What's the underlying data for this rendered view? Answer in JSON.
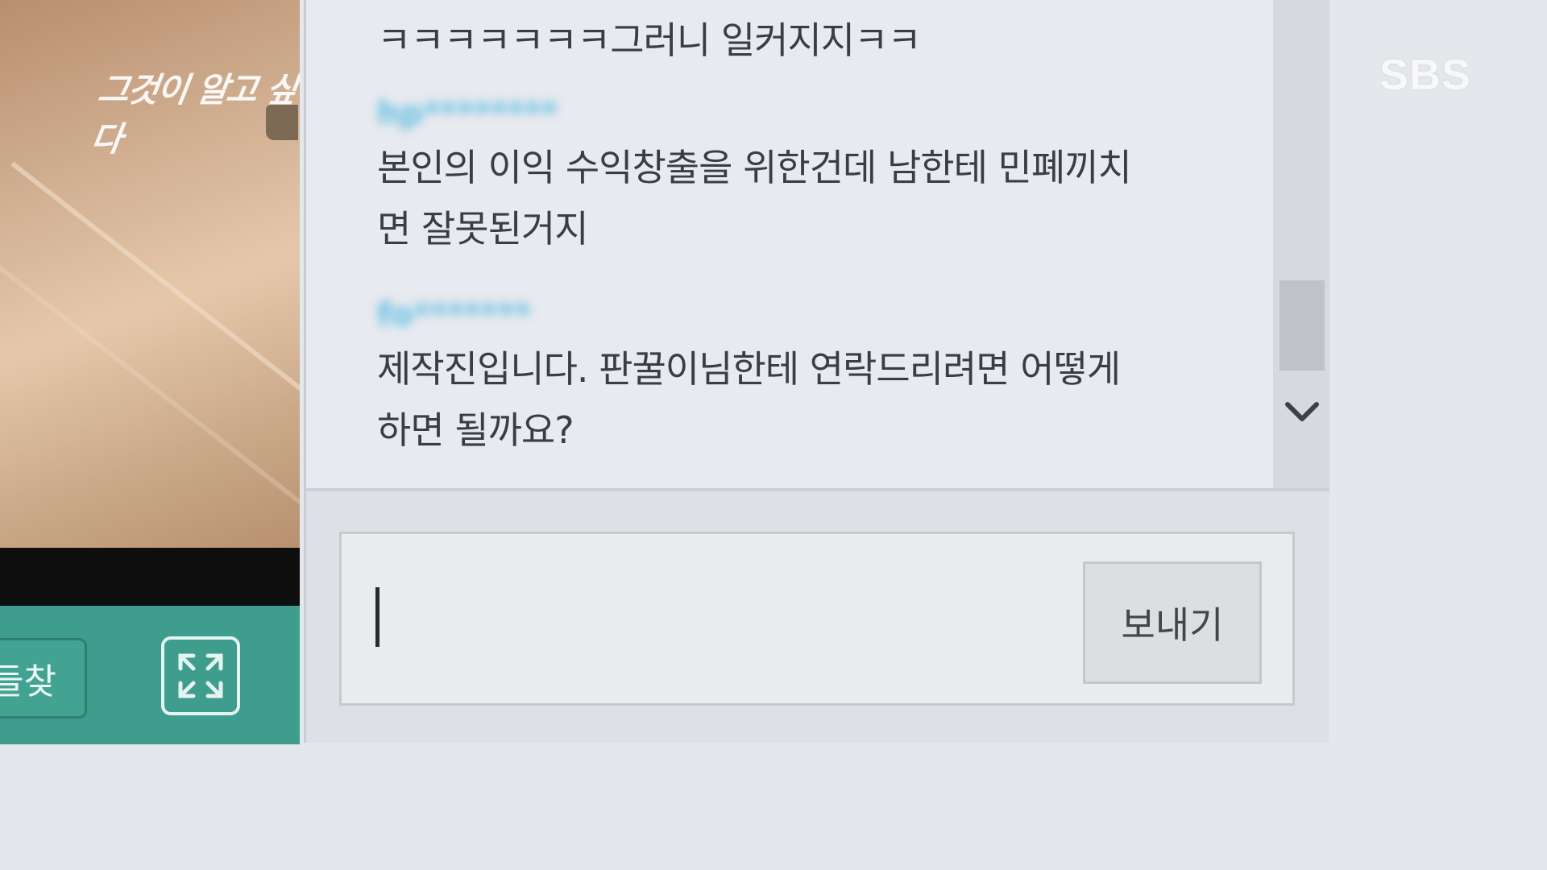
{
  "video": {
    "watermark": "그것이 알고 싶다",
    "prev_button_label": "들찾",
    "expand_icon": "expand-arrows-icon"
  },
  "broadcaster": {
    "logo": "SBS"
  },
  "chat": {
    "messages": [
      {
        "user": "",
        "text": "ㅋㅋㅋㅋㅋㅋㅋ그러니 일커지지ㅋㅋ"
      },
      {
        "user": "hp********",
        "text": "본인의 이익 수익창출을 위한건데 남한테 민폐끼치\n면 잘못된거지"
      },
      {
        "user": "fo*******",
        "text": "제작진입니다. 판꿀이님한테 연락드리려면 어떻게\n하면 될까요?"
      }
    ],
    "scroll_down_icon": "chevron-down-icon",
    "input": {
      "value": "",
      "placeholder": ""
    },
    "send_label": "보내기"
  },
  "colors": {
    "accent_teal": "#3e9d8c",
    "username_blue": "#4bb7e3",
    "panel_bg": "#e7eaee"
  }
}
